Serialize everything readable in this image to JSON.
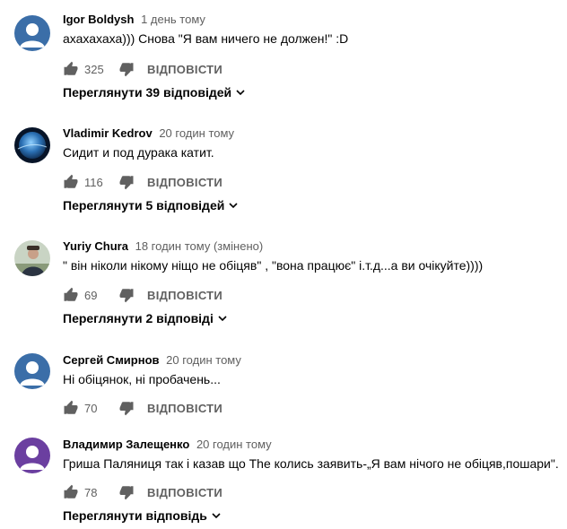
{
  "comments": [
    {
      "author": "Igor Boldysh",
      "time": "1 день тому",
      "text": "ахахахаха))) Снова \"Я вам ничего не должен!\" :D",
      "likes": "325",
      "reply_label": "ВІДПОВІСТИ",
      "view_replies": "Переглянути 39 відповідей",
      "avatar": "default-avatar"
    },
    {
      "author": "Vladimir Kedrov",
      "time": "20 годин тому",
      "text": "Сидит и под дурака катит.",
      "likes": "116",
      "reply_label": "ВІДПОВІСТИ",
      "view_replies": "Переглянути 5 відповідей",
      "avatar": "planet-avatar"
    },
    {
      "author": "Yuriy Chura",
      "time": "18 годин тому (змінено)",
      "text": "\" він ніколи нікому нiщо не обіцяв\" , \"вона працює\" і.т.д...а ви очікуйте))))",
      "likes": "69",
      "reply_label": "ВІДПОВІСТИ",
      "view_replies": "Переглянути 2 відповіді",
      "avatar": "photo-avatar"
    },
    {
      "author": "Сергей Смирнов",
      "time": "20 годин тому",
      "text": "Ні обіцянок, ні пробачень...",
      "likes": "70",
      "reply_label": "ВІДПОВІСТИ",
      "view_replies": "",
      "avatar": "default-avatar"
    },
    {
      "author": "Владимир Залещенко",
      "time": "20 годин тому",
      "text": "Гриша Паляниця так і казав що The колись заявить-„Я вам нічого не обіцяв,пошари\".",
      "likes": "78",
      "reply_label": "ВІДПОВІСТИ",
      "view_replies": "Переглянути відповідь",
      "avatar": "default-avatar-purple"
    }
  ],
  "colors": {
    "avatar_blue": "#3b6ea8",
    "avatar_purple": "#6b3fa0",
    "muted_text": "#606060",
    "primary_text": "#030303"
  }
}
